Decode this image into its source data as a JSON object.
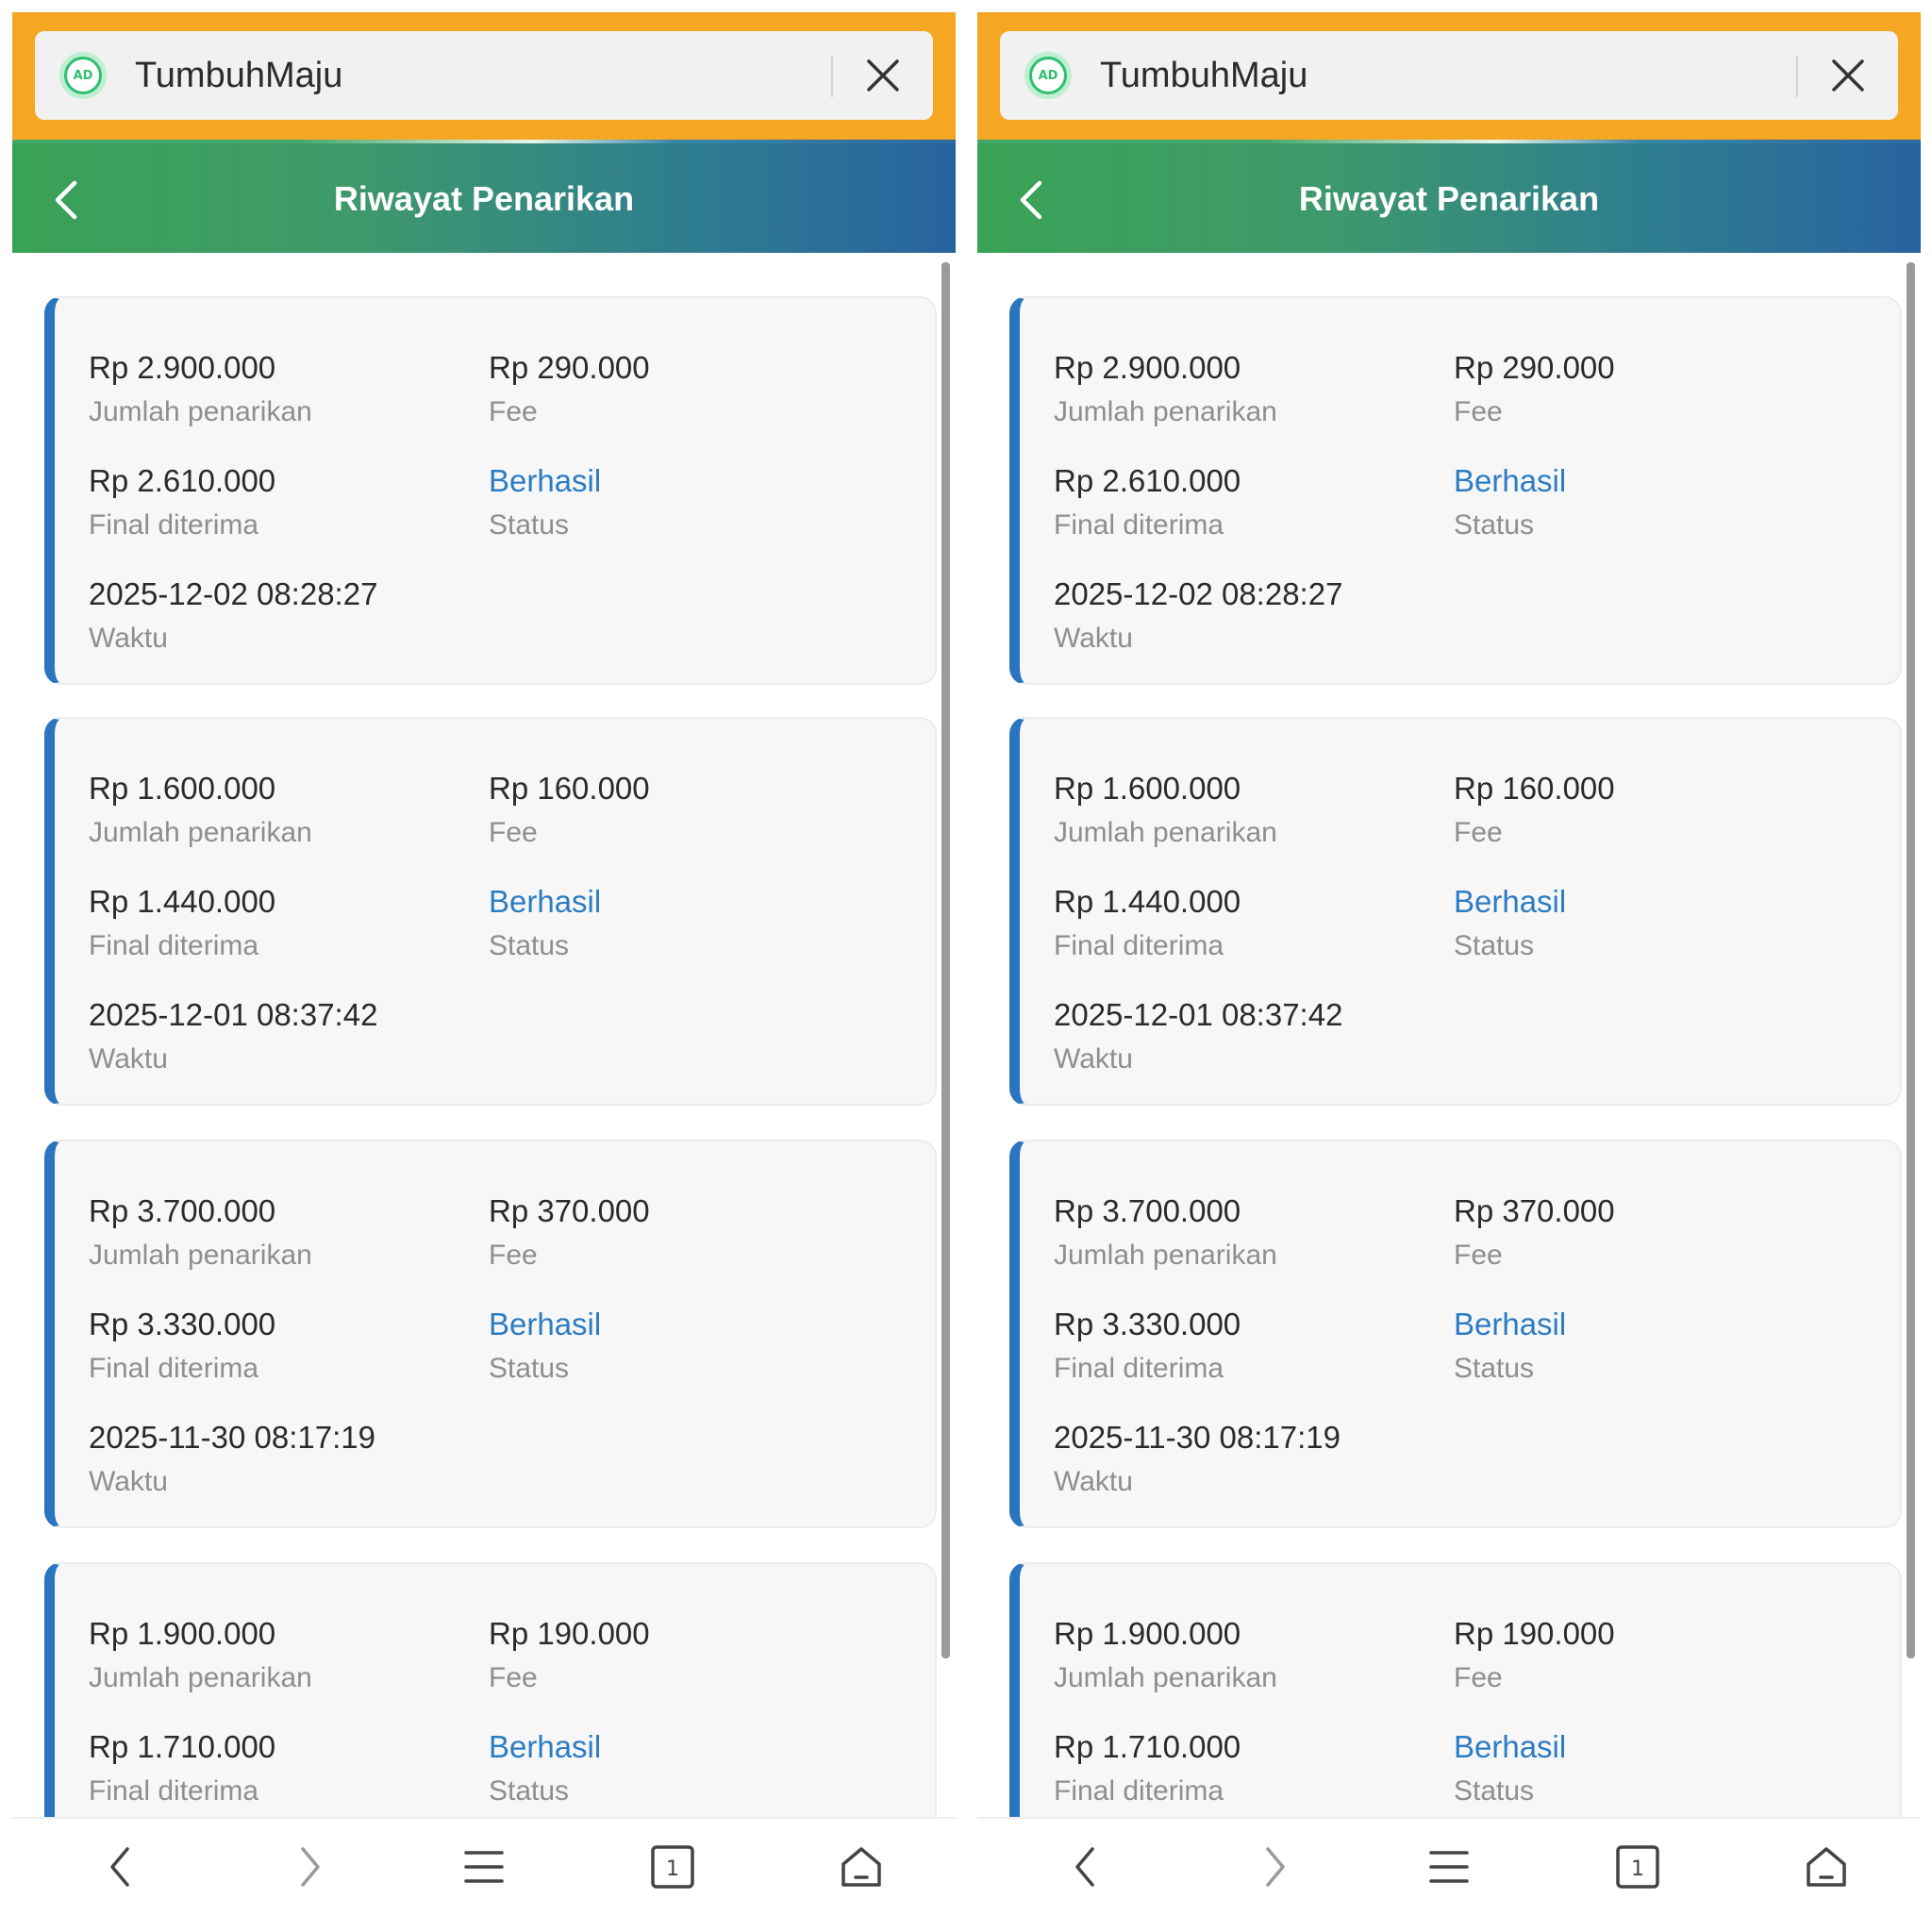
{
  "browser": {
    "ad_badge": "AD",
    "site_name": "TumbuhMaju",
    "close_icon": "close-icon"
  },
  "header": {
    "title": "Riwayat Penarikan",
    "back_icon": "chevron-left-icon"
  },
  "labels": {
    "amount": "Jumlah penarikan",
    "fee": "Fee",
    "final": "Final diterima",
    "status": "Status",
    "time": "Waktu"
  },
  "records": [
    {
      "amount": "Rp 2.900.000",
      "fee": "Rp 290.000",
      "final": "Rp 2.610.000",
      "status": "Berhasil",
      "time": "2025-12-02 08:28:27"
    },
    {
      "amount": "Rp 1.600.000",
      "fee": "Rp 160.000",
      "final": "Rp 1.440.000",
      "status": "Berhasil",
      "time": "2025-12-01 08:37:42"
    },
    {
      "amount": "Rp 3.700.000",
      "fee": "Rp 370.000",
      "final": "Rp 3.330.000",
      "status": "Berhasil",
      "time": "2025-11-30 08:17:19"
    },
    {
      "amount": "Rp 1.900.000",
      "fee": "Rp 190.000",
      "final": "Rp 1.710.000",
      "status": "Berhasil",
      "time": ""
    }
  ],
  "bottom_nav": {
    "tab_count": "1",
    "icons": [
      "back-arrow-icon",
      "forward-arrow-icon",
      "menu-icon",
      "tabs-icon",
      "home-icon"
    ]
  },
  "colors": {
    "browser_bar": "#f5a623",
    "header_start": "#3aa255",
    "header_end": "#2863a0",
    "card_accent": "#2b75c0",
    "status_success": "#2b7cc4"
  }
}
